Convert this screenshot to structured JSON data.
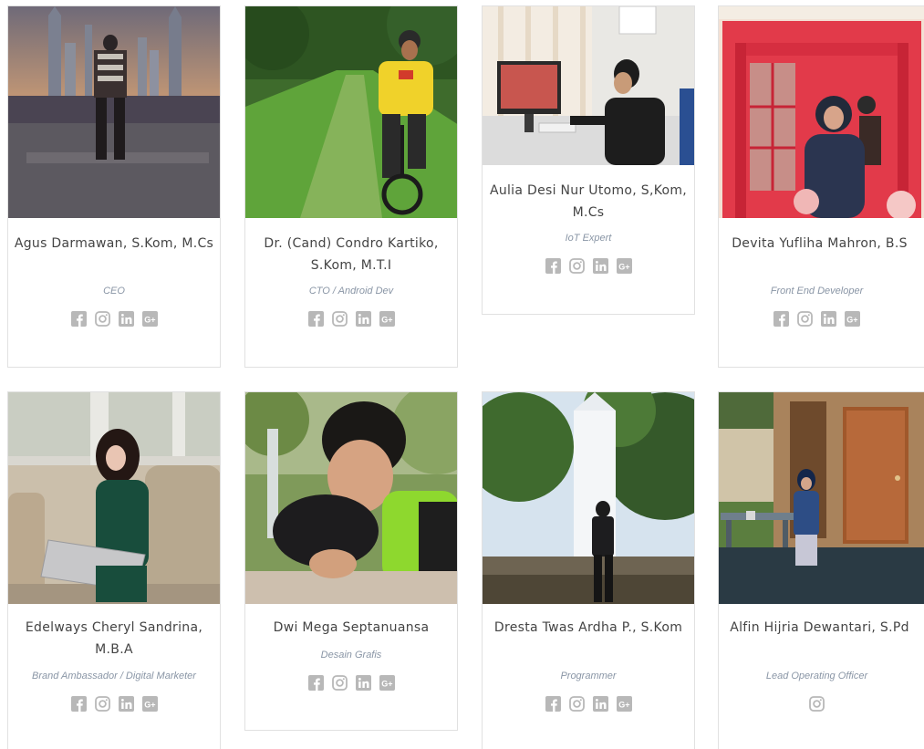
{
  "colors": {
    "name_text": "#444444",
    "role_text": "#8a96a6",
    "icon": "#b8b8b8",
    "border": "#e1e1e1"
  },
  "team": [
    {
      "name": "Agus Darmawan, S.Kom, M.Cs",
      "role": "CEO",
      "icons": [
        "facebook-icon",
        "instagram-icon",
        "linkedin-icon",
        "google-plus-icon"
      ]
    },
    {
      "name": "Dr. (Cand) Condro Kartiko, S.Kom, M.T.I",
      "role": "CTO / Android Dev",
      "icons": [
        "facebook-icon",
        "instagram-icon",
        "linkedin-icon",
        "google-plus-icon"
      ]
    },
    {
      "name": "Aulia Desi Nur Utomo, S,Kom, M.Cs",
      "role": "IoT Expert",
      "icons": [
        "facebook-icon",
        "instagram-icon",
        "linkedin-icon",
        "google-plus-icon"
      ]
    },
    {
      "name": "Devita Yufliha Mahron, B.S",
      "role": "Front End Developer",
      "icons": [
        "facebook-icon",
        "instagram-icon",
        "linkedin-icon",
        "google-plus-icon"
      ]
    },
    {
      "name": "Edelways Cheryl Sandrina, M.B.A",
      "role": "Brand Ambassador / Digital Marketer",
      "icons": [
        "facebook-icon",
        "instagram-icon",
        "linkedin-icon",
        "google-plus-icon"
      ]
    },
    {
      "name": "Dwi Mega Septanuansa",
      "role": "Desain Grafis",
      "icons": [
        "facebook-icon",
        "instagram-icon",
        "linkedin-icon",
        "google-plus-icon"
      ]
    },
    {
      "name": "Dresta Twas Ardha P., S.Kom",
      "role": "Programmer",
      "icons": [
        "facebook-icon",
        "instagram-icon",
        "linkedin-icon",
        "google-plus-icon"
      ]
    },
    {
      "name": "Alfin Hijria Dewantari, S.Pd",
      "role": "Lead Operating Officer",
      "icons": [
        "instagram-icon"
      ]
    }
  ]
}
